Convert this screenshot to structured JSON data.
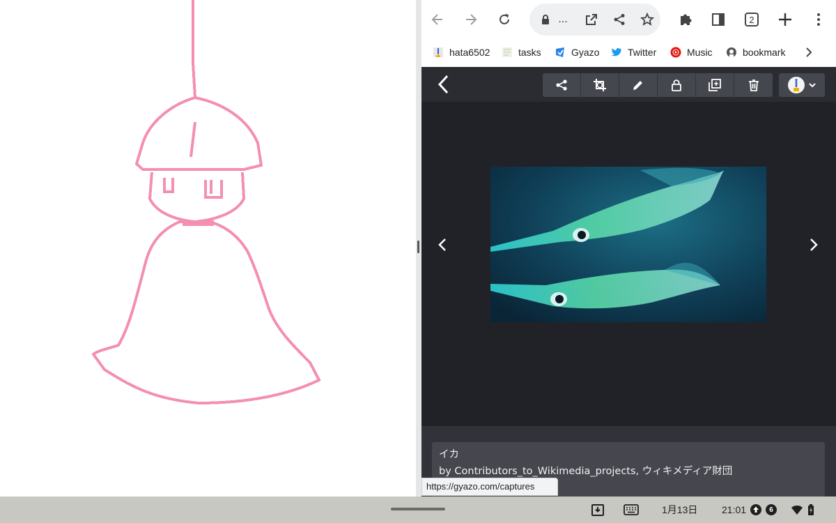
{
  "browser": {
    "tab_count": "2",
    "omnibox_text": "...",
    "bookmarks": [
      {
        "label": "hata6502",
        "icon": "profile-icon"
      },
      {
        "label": "tasks",
        "icon": "folder-icon"
      },
      {
        "label": "Gyazo",
        "icon": "gyazo-icon"
      },
      {
        "label": "Twitter",
        "icon": "twitter-icon"
      },
      {
        "label": "Music",
        "icon": "youtube-music-icon"
      },
      {
        "label": "bookmark",
        "icon": "github-icon"
      }
    ],
    "status_url": "https://gyazo.com/captures"
  },
  "viewer": {
    "actions": [
      "share-icon",
      "crop-icon",
      "pencil-icon",
      "lock-icon",
      "duplicate-icon",
      "trash-icon"
    ],
    "caption_title": "イカ",
    "caption_source": "by Contributors_to_Wikimedia_projects, ウィキメディア財団"
  },
  "shelf": {
    "date": "1月13日",
    "time": "21:01",
    "notification_count": "6"
  },
  "colors": {
    "sketch_pink": "#f48fb1",
    "viewer_bg": "#212228",
    "shelf_bg": "#c8c8c2"
  }
}
